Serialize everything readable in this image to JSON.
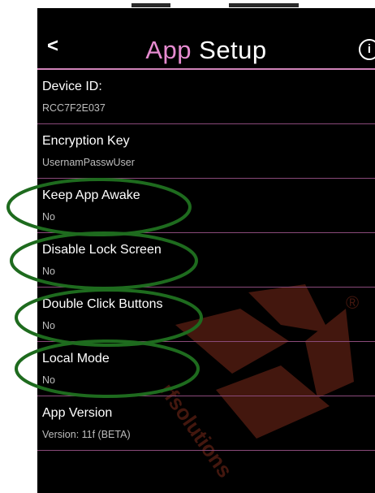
{
  "header": {
    "back_glyph": "<",
    "title_accent": "App",
    "title_rest": "Setup",
    "info_glyph": "i"
  },
  "settings": [
    {
      "label": "Device ID:",
      "value": "RCC7F2E037"
    },
    {
      "label": "Encryption Key",
      "value": "UsernamPasswUser"
    },
    {
      "label": "Keep App Awake",
      "value": "No"
    },
    {
      "label": "Disable Lock Screen",
      "value": "No"
    },
    {
      "label": "Double Click Buttons",
      "value": "No"
    },
    {
      "label": "Local Mode",
      "value": "No"
    },
    {
      "label": "App Version",
      "value": "Version: 11f (BETA)"
    }
  ],
  "watermark": {
    "text": "rfsolutions",
    "registered_mark": "®",
    "color": "#7a2a1a"
  },
  "colors": {
    "accent": "#e68bd0",
    "divider": "#8a4a7a",
    "annotation": "#1e6b1e"
  }
}
